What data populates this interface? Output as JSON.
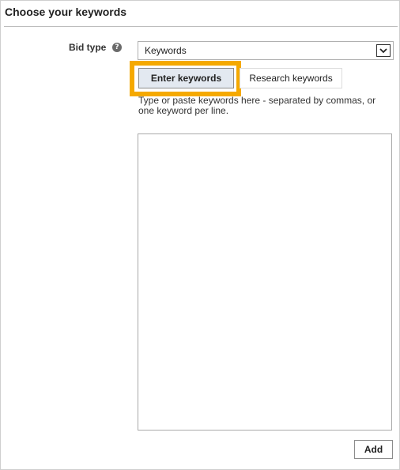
{
  "panel": {
    "title": "Choose your keywords"
  },
  "bid_type": {
    "label": "Bid type",
    "help_glyph": "?",
    "selected": "Keywords"
  },
  "tabs": {
    "enter_label": "Enter keywords",
    "research_label": "Research keywords",
    "highlight_color": "#f5a900"
  },
  "instructions": "Type or paste keywords here - separated by commas, or one keyword per line.",
  "keywords_input": {
    "value": ""
  },
  "actions": {
    "add_label": "Add"
  }
}
